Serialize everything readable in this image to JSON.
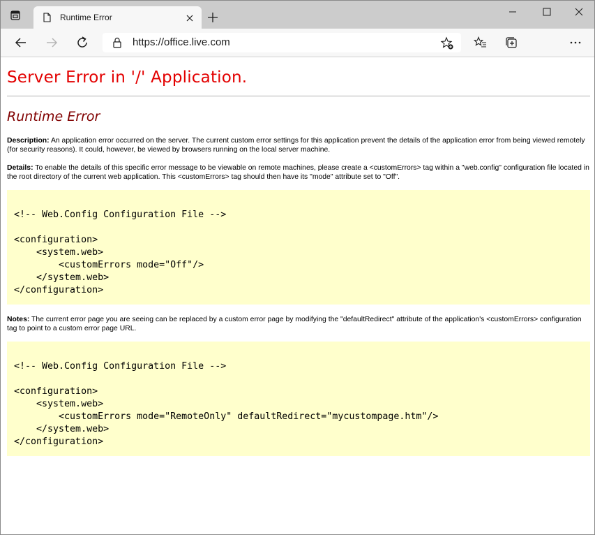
{
  "browser": {
    "tab_title": "Runtime Error",
    "url": "https://office.live.com"
  },
  "page": {
    "heading": "Server Error in '/' Application.",
    "subheading": "Runtime Error",
    "description_label": "Description:",
    "description_text": " An application error occurred on the server. The current custom error settings for this application prevent the details of the application error from being viewed remotely (for security reasons). It could, however, be viewed by browsers running on the local server machine.",
    "details_label": "Details:",
    "details_text": " To enable the details of this specific error message to be viewable on remote machines, please create a <customErrors> tag within a \"web.config\" configuration file located in the root directory of the current web application. This <customErrors> tag should then have its \"mode\" attribute set to \"Off\".",
    "code1": "<!-- Web.Config Configuration File -->\n\n<configuration>\n    <system.web>\n        <customErrors mode=\"Off\"/>\n    </system.web>\n</configuration>",
    "notes_label": "Notes:",
    "notes_text": " The current error page you are seeing can be replaced by a custom error page by modifying the \"defaultRedirect\" attribute of the application's <customErrors> configuration tag to point to a custom error page URL.",
    "code2": "<!-- Web.Config Configuration File -->\n\n<configuration>\n    <system.web>\n        <customErrors mode=\"RemoteOnly\" defaultRedirect=\"mycustompage.htm\"/>\n    </system.web>\n</configuration>"
  },
  "colors": {
    "heading": "#e30000",
    "subheading": "#800000",
    "code_background": "#ffffcc"
  }
}
